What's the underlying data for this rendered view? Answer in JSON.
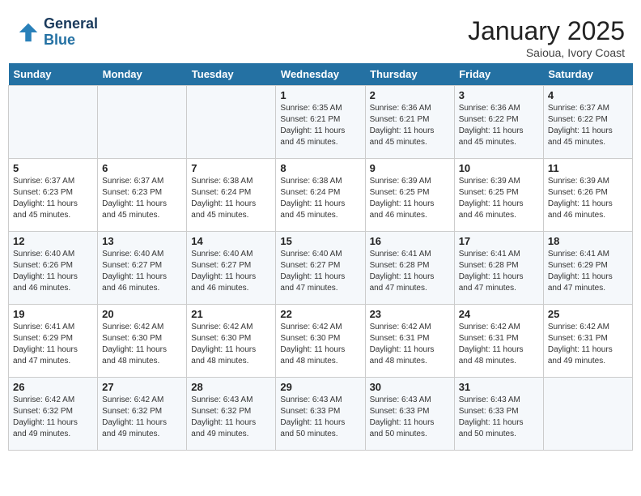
{
  "header": {
    "logo_line1": "General",
    "logo_line2": "Blue",
    "month": "January 2025",
    "location": "Saioua, Ivory Coast"
  },
  "weekdays": [
    "Sunday",
    "Monday",
    "Tuesday",
    "Wednesday",
    "Thursday",
    "Friday",
    "Saturday"
  ],
  "weeks": [
    [
      {
        "day": "",
        "info": ""
      },
      {
        "day": "",
        "info": ""
      },
      {
        "day": "",
        "info": ""
      },
      {
        "day": "1",
        "info": "Sunrise: 6:35 AM\nSunset: 6:21 PM\nDaylight: 11 hours\nand 45 minutes."
      },
      {
        "day": "2",
        "info": "Sunrise: 6:36 AM\nSunset: 6:21 PM\nDaylight: 11 hours\nand 45 minutes."
      },
      {
        "day": "3",
        "info": "Sunrise: 6:36 AM\nSunset: 6:22 PM\nDaylight: 11 hours\nand 45 minutes."
      },
      {
        "day": "4",
        "info": "Sunrise: 6:37 AM\nSunset: 6:22 PM\nDaylight: 11 hours\nand 45 minutes."
      }
    ],
    [
      {
        "day": "5",
        "info": "Sunrise: 6:37 AM\nSunset: 6:23 PM\nDaylight: 11 hours\nand 45 minutes."
      },
      {
        "day": "6",
        "info": "Sunrise: 6:37 AM\nSunset: 6:23 PM\nDaylight: 11 hours\nand 45 minutes."
      },
      {
        "day": "7",
        "info": "Sunrise: 6:38 AM\nSunset: 6:24 PM\nDaylight: 11 hours\nand 45 minutes."
      },
      {
        "day": "8",
        "info": "Sunrise: 6:38 AM\nSunset: 6:24 PM\nDaylight: 11 hours\nand 45 minutes."
      },
      {
        "day": "9",
        "info": "Sunrise: 6:39 AM\nSunset: 6:25 PM\nDaylight: 11 hours\nand 46 minutes."
      },
      {
        "day": "10",
        "info": "Sunrise: 6:39 AM\nSunset: 6:25 PM\nDaylight: 11 hours\nand 46 minutes."
      },
      {
        "day": "11",
        "info": "Sunrise: 6:39 AM\nSunset: 6:26 PM\nDaylight: 11 hours\nand 46 minutes."
      }
    ],
    [
      {
        "day": "12",
        "info": "Sunrise: 6:40 AM\nSunset: 6:26 PM\nDaylight: 11 hours\nand 46 minutes."
      },
      {
        "day": "13",
        "info": "Sunrise: 6:40 AM\nSunset: 6:27 PM\nDaylight: 11 hours\nand 46 minutes."
      },
      {
        "day": "14",
        "info": "Sunrise: 6:40 AM\nSunset: 6:27 PM\nDaylight: 11 hours\nand 46 minutes."
      },
      {
        "day": "15",
        "info": "Sunrise: 6:40 AM\nSunset: 6:27 PM\nDaylight: 11 hours\nand 47 minutes."
      },
      {
        "day": "16",
        "info": "Sunrise: 6:41 AM\nSunset: 6:28 PM\nDaylight: 11 hours\nand 47 minutes."
      },
      {
        "day": "17",
        "info": "Sunrise: 6:41 AM\nSunset: 6:28 PM\nDaylight: 11 hours\nand 47 minutes."
      },
      {
        "day": "18",
        "info": "Sunrise: 6:41 AM\nSunset: 6:29 PM\nDaylight: 11 hours\nand 47 minutes."
      }
    ],
    [
      {
        "day": "19",
        "info": "Sunrise: 6:41 AM\nSunset: 6:29 PM\nDaylight: 11 hours\nand 47 minutes."
      },
      {
        "day": "20",
        "info": "Sunrise: 6:42 AM\nSunset: 6:30 PM\nDaylight: 11 hours\nand 48 minutes."
      },
      {
        "day": "21",
        "info": "Sunrise: 6:42 AM\nSunset: 6:30 PM\nDaylight: 11 hours\nand 48 minutes."
      },
      {
        "day": "22",
        "info": "Sunrise: 6:42 AM\nSunset: 6:30 PM\nDaylight: 11 hours\nand 48 minutes."
      },
      {
        "day": "23",
        "info": "Sunrise: 6:42 AM\nSunset: 6:31 PM\nDaylight: 11 hours\nand 48 minutes."
      },
      {
        "day": "24",
        "info": "Sunrise: 6:42 AM\nSunset: 6:31 PM\nDaylight: 11 hours\nand 48 minutes."
      },
      {
        "day": "25",
        "info": "Sunrise: 6:42 AM\nSunset: 6:31 PM\nDaylight: 11 hours\nand 49 minutes."
      }
    ],
    [
      {
        "day": "26",
        "info": "Sunrise: 6:42 AM\nSunset: 6:32 PM\nDaylight: 11 hours\nand 49 minutes."
      },
      {
        "day": "27",
        "info": "Sunrise: 6:42 AM\nSunset: 6:32 PM\nDaylight: 11 hours\nand 49 minutes."
      },
      {
        "day": "28",
        "info": "Sunrise: 6:43 AM\nSunset: 6:32 PM\nDaylight: 11 hours\nand 49 minutes."
      },
      {
        "day": "29",
        "info": "Sunrise: 6:43 AM\nSunset: 6:33 PM\nDaylight: 11 hours\nand 50 minutes."
      },
      {
        "day": "30",
        "info": "Sunrise: 6:43 AM\nSunset: 6:33 PM\nDaylight: 11 hours\nand 50 minutes."
      },
      {
        "day": "31",
        "info": "Sunrise: 6:43 AM\nSunset: 6:33 PM\nDaylight: 11 hours\nand 50 minutes."
      },
      {
        "day": "",
        "info": ""
      }
    ]
  ]
}
